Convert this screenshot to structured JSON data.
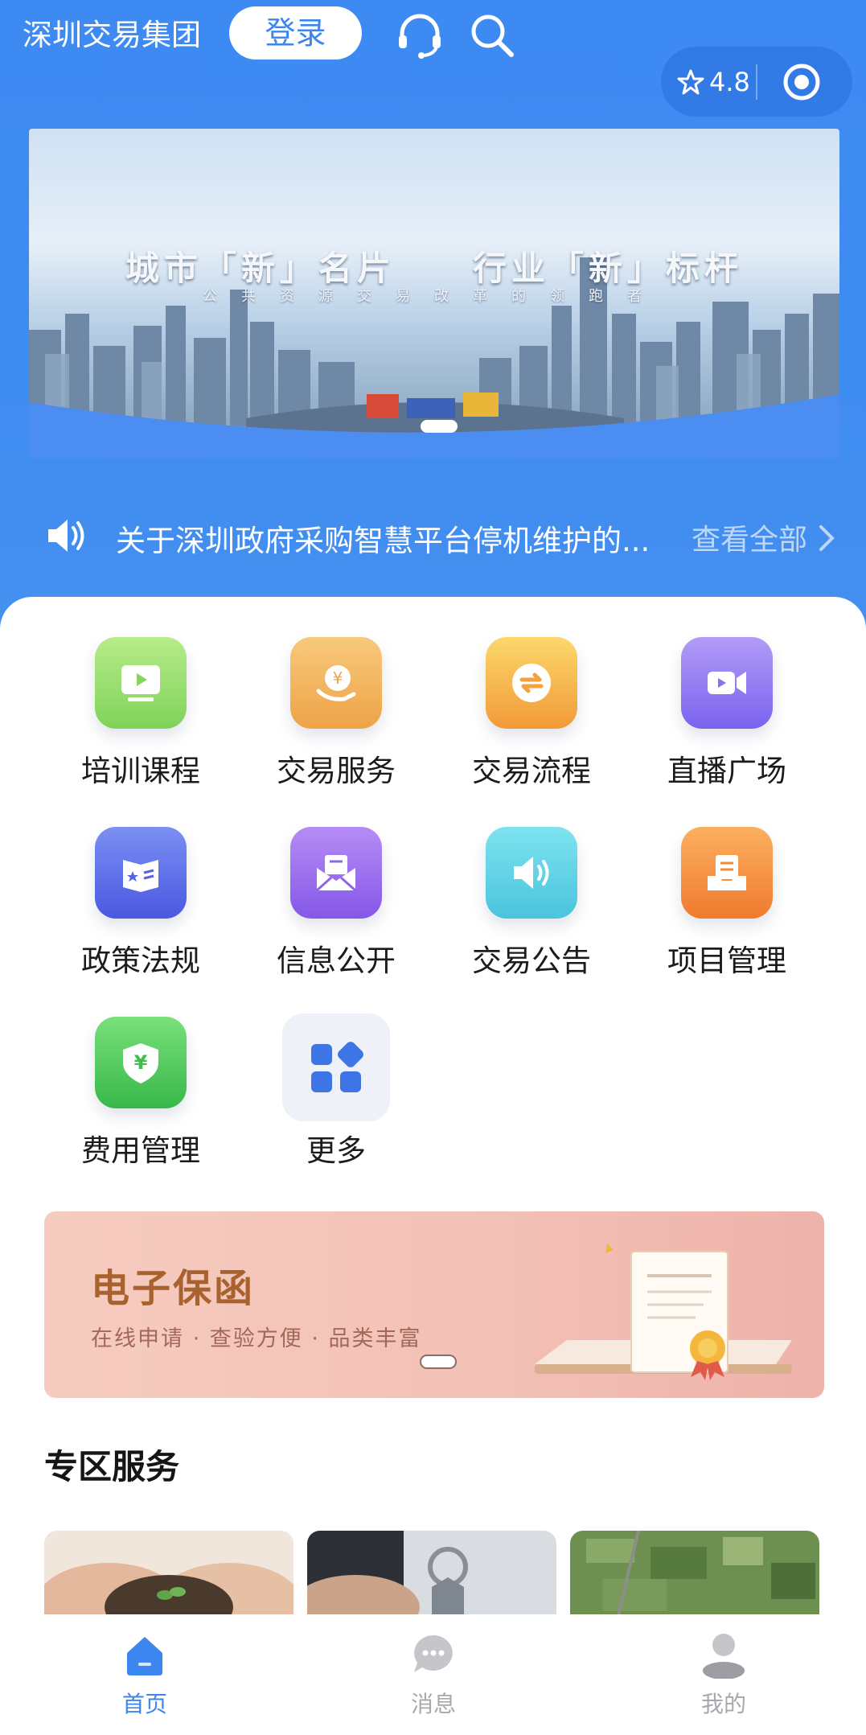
{
  "header": {
    "brand": "深圳交易集团",
    "login_label": "登录",
    "rating": "4.8"
  },
  "banner": {
    "title": "城市「新」名片　　行业「新」标杆",
    "subtitle": "公共资源交易改革的领跑者"
  },
  "notice": {
    "text": "关于深圳政府采购智慧平台停机维护的...",
    "more": "查看全部"
  },
  "grid": [
    {
      "label": "培训课程",
      "icon": "play-screen-icon",
      "color_top": "#b7ec8a",
      "color_bottom": "#7fd25a"
    },
    {
      "label": "交易服务",
      "icon": "yuan-hand-icon",
      "color_top": "#f7c97c",
      "color_bottom": "#efa347"
    },
    {
      "label": "交易流程",
      "icon": "swap-arrows-icon",
      "color_top": "#fbd86b",
      "color_bottom": "#f29a38"
    },
    {
      "label": "直播广场",
      "icon": "video-camera-icon",
      "color_top": "#b29cf7",
      "color_bottom": "#7a62ee"
    },
    {
      "label": "政策法规",
      "icon": "star-book-icon",
      "color_top": "#7b8ff4",
      "color_bottom": "#4a58e0"
    },
    {
      "label": "信息公开",
      "icon": "envelope-icon",
      "color_top": "#b58cf5",
      "color_bottom": "#8558e8"
    },
    {
      "label": "交易公告",
      "icon": "speaker-icon",
      "color_top": "#7ee3ef",
      "color_bottom": "#4ac4de"
    },
    {
      "label": "项目管理",
      "icon": "document-tray-icon",
      "color_top": "#fbb05f",
      "color_bottom": "#f07a2e"
    },
    {
      "label": "费用管理",
      "icon": "yuan-shield-icon",
      "color_top": "#79e07a",
      "color_bottom": "#37b84a"
    },
    {
      "label": "更多",
      "icon": "more-grid-icon",
      "color_top": "#f1f3f8",
      "color_bottom": "#eceff6"
    }
  ],
  "promo": {
    "title": "电子保函",
    "subtitle": "在线申请 · 查验方便 · 品类丰富"
  },
  "section": {
    "title": "专区服务"
  },
  "tabbar": [
    {
      "label": "首页",
      "icon": "home-icon",
      "active": true
    },
    {
      "label": "消息",
      "icon": "message-icon",
      "active": false
    },
    {
      "label": "我的",
      "icon": "profile-icon",
      "active": false
    }
  ],
  "colors": {
    "primary": "#3d86f0",
    "tab_inactive": "#a7a9ad"
  }
}
